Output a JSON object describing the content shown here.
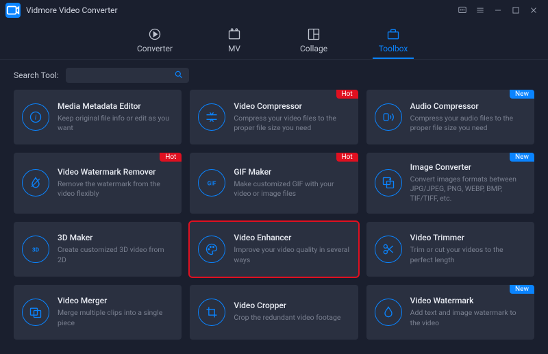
{
  "app": {
    "title": "Vidmore Video Converter"
  },
  "nav": {
    "converter": "Converter",
    "mv": "MV",
    "collage": "Collage",
    "toolbox": "Toolbox"
  },
  "search": {
    "label": "Search Tool:",
    "value": ""
  },
  "badges": {
    "hot": "Hot",
    "new": "New"
  },
  "tools": [
    {
      "key": "media-metadata-editor",
      "title": "Media Metadata Editor",
      "desc": "Keep original file info or edit as you want",
      "badge": null,
      "highlight": false
    },
    {
      "key": "video-compressor",
      "title": "Video Compressor",
      "desc": "Compress your video files to the proper file size you need",
      "badge": "hot",
      "highlight": false
    },
    {
      "key": "audio-compressor",
      "title": "Audio Compressor",
      "desc": "Compress your audio files to the proper file size you need",
      "badge": "new",
      "highlight": false
    },
    {
      "key": "video-watermark-remover",
      "title": "Video Watermark Remover",
      "desc": "Remove the watermark from the video flexibly",
      "badge": "hot",
      "highlight": false
    },
    {
      "key": "gif-maker",
      "title": "GIF Maker",
      "desc": "Make customized GIF with your video or image files",
      "badge": "hot",
      "highlight": false
    },
    {
      "key": "image-converter",
      "title": "Image Converter",
      "desc": "Convert images formats between JPG/JPEG, PNG, WEBP, BMP, TIF/TIFF, etc.",
      "badge": "new",
      "highlight": false
    },
    {
      "key": "3d-maker",
      "title": "3D Maker",
      "desc": "Create customized 3D video from 2D",
      "badge": null,
      "highlight": false
    },
    {
      "key": "video-enhancer",
      "title": "Video Enhancer",
      "desc": "Improve your video quality in several ways",
      "badge": null,
      "highlight": true
    },
    {
      "key": "video-trimmer",
      "title": "Video Trimmer",
      "desc": "Trim or cut your videos to the perfect length",
      "badge": null,
      "highlight": false
    },
    {
      "key": "video-merger",
      "title": "Video Merger",
      "desc": "Merge multiple clips into a single piece",
      "badge": null,
      "highlight": false
    },
    {
      "key": "video-cropper",
      "title": "Video Cropper",
      "desc": "Crop the redundant video footage",
      "badge": null,
      "highlight": false
    },
    {
      "key": "video-watermark",
      "title": "Video Watermark",
      "desc": "Add text and image watermark to the video",
      "badge": "new",
      "highlight": false
    }
  ],
  "icons": {
    "media-metadata-editor": "info",
    "video-compressor": "compress",
    "audio-compressor": "audio",
    "video-watermark-remover": "removewm",
    "gif-maker": "gif",
    "image-converter": "imgconv",
    "3d-maker": "3d",
    "video-enhancer": "palette",
    "video-trimmer": "scissors",
    "video-merger": "merge",
    "video-cropper": "crop",
    "video-watermark": "drop"
  }
}
